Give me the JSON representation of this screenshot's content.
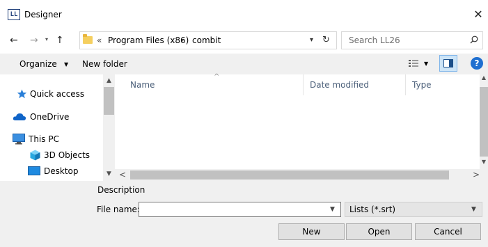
{
  "window": {
    "title": "Designer",
    "app_icon_text": "LL",
    "close_glyph": "✕"
  },
  "address": {
    "back_glyph": "←",
    "forward_glyph": "→",
    "recent_glyph": "▾",
    "up_glyph": "↑",
    "chevrons": "«",
    "segments": [
      "Program Files (x86)",
      "combit"
    ],
    "separator": "›",
    "dropdown_glyph": "▾",
    "refresh_glyph": "↻"
  },
  "search": {
    "placeholder": "Search LL26"
  },
  "toolbar": {
    "organize_label": "Organize",
    "organize_caret": "▼",
    "new_folder_label": "New folder",
    "view_caret": "▼",
    "help_label": "?"
  },
  "nav_pane": {
    "items": [
      {
        "label": "Quick access",
        "icon": "star-icon"
      },
      {
        "label": "OneDrive",
        "icon": "cloud-icon"
      },
      {
        "label": "This PC",
        "icon": "computer-icon"
      },
      {
        "label": "3D Objects",
        "icon": "cube-icon"
      },
      {
        "label": "Desktop",
        "icon": "desktop-icon"
      }
    ],
    "scroll_up": "▲",
    "scroll_down": "▼"
  },
  "file_list": {
    "sort_caret": "^",
    "columns": [
      "Name",
      "Date modified",
      "Type"
    ],
    "scroll_left": "<",
    "scroll_right": ">",
    "scroll_up": "▲",
    "scroll_down": "▼"
  },
  "bottom": {
    "description_label": "Description",
    "filename_label": "File name:",
    "filename_value": "",
    "filename_caret": "▼",
    "filter_value": "Lists (*.srt)",
    "filter_caret": "▼",
    "buttons": {
      "new": "New",
      "open": "Open",
      "cancel": "Cancel"
    }
  },
  "colors": {
    "accent": "#1f6fd0",
    "folder": "#f5cf5f",
    "toolbar_bg": "#f0f0f0",
    "header_text": "#4c607a"
  }
}
